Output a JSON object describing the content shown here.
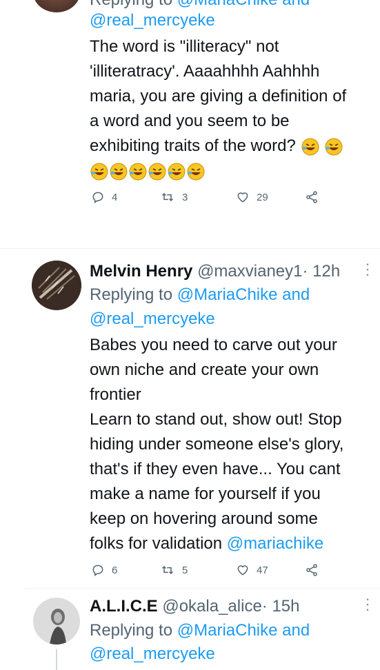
{
  "tweet1": {
    "replying_prefix": "Replying to",
    "replying_mention": "@MariaChike and",
    "replying_mention2": "@real_mercyeke",
    "body_lines": [
      "The word is \"illiteracy\" not",
      "'illiteratracy'. Aaaahhhh Aahhhh",
      "maria, you are giving a definition of",
      "a word and you seem to be",
      "exhibiting traits of the word?"
    ],
    "emoji_name": "rolling-on-floor-laughing",
    "reply_count": "4",
    "retweet_count": "3",
    "like_count": "29"
  },
  "tweet2": {
    "name": "Melvin Henry",
    "handle": "@maxvianey1",
    "time": "· 12h",
    "replying_prefix": "Replying to",
    "replying_mention": "@MariaChike and",
    "replying_mention2": "@real_mercyeke",
    "body_lines": [
      "Babes you need to carve out your",
      "own niche and create your own",
      "frontier",
      "Learn to stand out, show out! Stop",
      "hiding under someone else's glory,",
      "that's if  they even have... You cant",
      "make a name for yourself if you",
      "keep on hovering around some",
      "folks for validation"
    ],
    "body_mention": "@mariachike",
    "reply_count": "6",
    "retweet_count": "5",
    "like_count": "47"
  },
  "tweet3": {
    "name": "A.L.I.C.E",
    "handle": "@okala_alice",
    "time": "· 15h",
    "replying_prefix": "Replying to",
    "replying_mention": "@MariaChike and",
    "replying_mention2": "@real_mercyeke"
  },
  "colors": {
    "link": "#1d9bf0",
    "muted": "#536471",
    "text": "#0f1419"
  }
}
